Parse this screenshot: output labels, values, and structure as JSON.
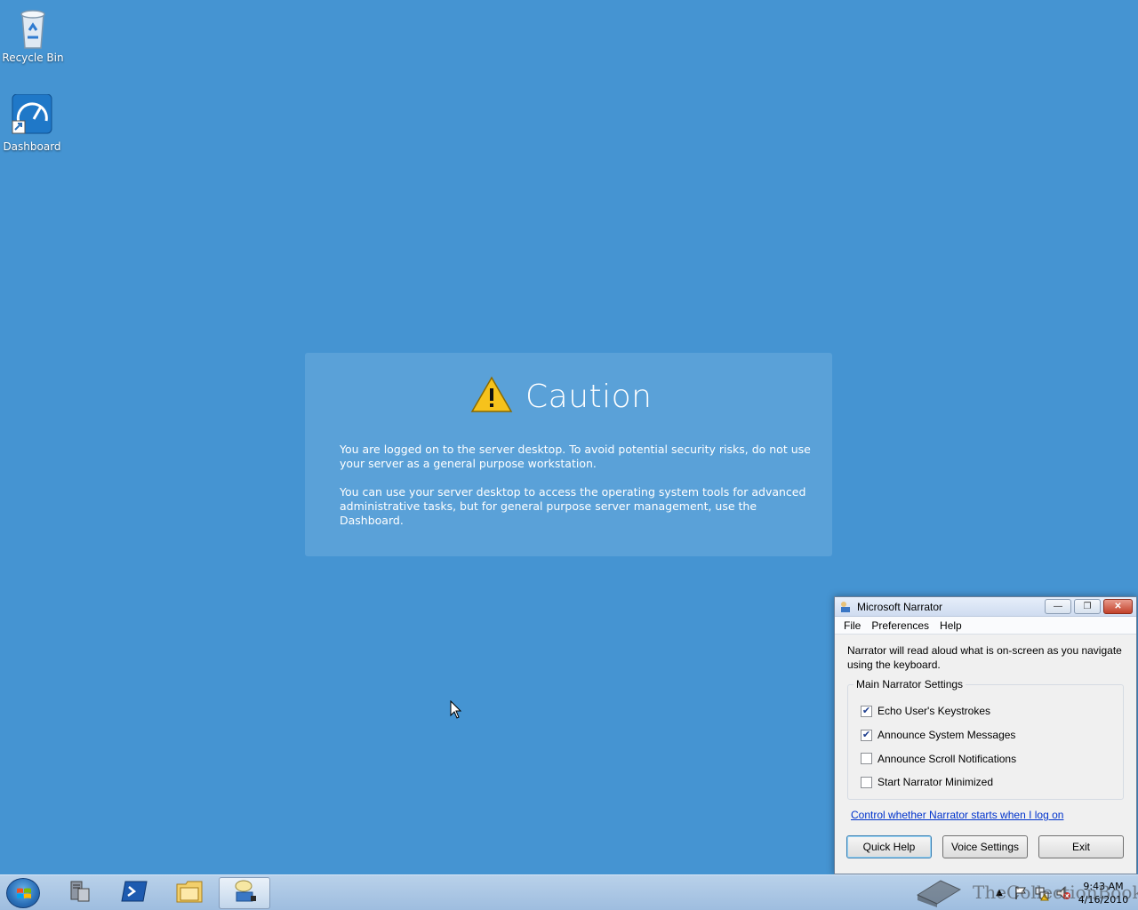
{
  "desktop": {
    "icons": [
      {
        "label": "Recycle Bin",
        "icon": "recycle-bin-icon"
      },
      {
        "label": "Dashboard",
        "icon": "dashboard-icon"
      }
    ]
  },
  "caution": {
    "title": "Caution",
    "icon": "warning-icon",
    "para1": "You are logged on to the server desktop. To avoid potential security risks, do not use your server as a general purpose workstation.",
    "para2": "You can use your server desktop to access the operating system tools for advanced administrative tasks, but for general purpose server management, use the Dashboard."
  },
  "narrator": {
    "title": "Microsoft Narrator",
    "menu": [
      "File",
      "Preferences",
      "Help"
    ],
    "description": "Narrator will read aloud what is on-screen as you navigate using the keyboard.",
    "group_label": "Main Narrator Settings",
    "options": [
      {
        "label": "Echo User's Keystrokes",
        "checked": true
      },
      {
        "label": "Announce System Messages",
        "checked": true
      },
      {
        "label": "Announce Scroll Notifications",
        "checked": false
      },
      {
        "label": "Start Narrator Minimized",
        "checked": false
      }
    ],
    "link": "Control whether Narrator starts when I log on",
    "buttons": {
      "quick_help": "Quick Help",
      "voice_settings": "Voice Settings",
      "exit": "Exit"
    }
  },
  "taskbar": {
    "pinned": [
      "server-manager-icon",
      "powershell-icon",
      "explorer-icon",
      "narrator-icon"
    ],
    "watermark": "TheCollectionBook",
    "clock_time": "9:43 AM",
    "clock_date": "4/16/2010"
  },
  "colors": {
    "desktop": "#4594d2",
    "caution_panel": "#5aa1d8",
    "taskbar": "#b9d1ea"
  }
}
